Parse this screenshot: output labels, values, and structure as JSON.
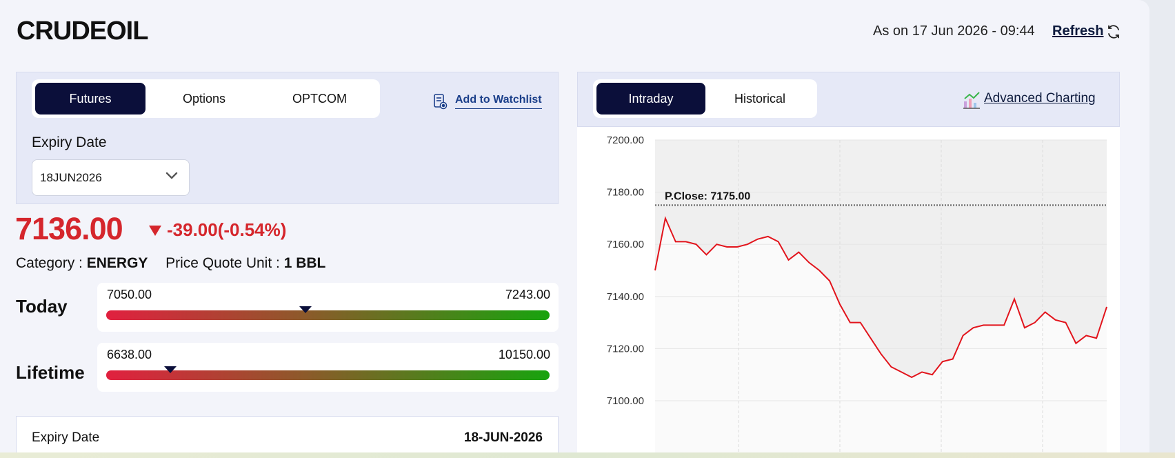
{
  "header": {
    "title": "CRUDEOIL",
    "as_on": "As on 17 Jun 2026 - 09:44",
    "refresh_label": "Refresh"
  },
  "left": {
    "tabs": [
      {
        "label": "Futures",
        "active": true
      },
      {
        "label": "Options",
        "active": false
      },
      {
        "label": "OPTCOM",
        "active": false
      }
    ],
    "watchlist_label": "Add to Watchlist",
    "expiry_label": "Expiry Date",
    "expiry_value": "18JUN2026",
    "price": "7136.00",
    "change": "-39.00(-0.54%)",
    "category_label": "Category :",
    "category_value": "ENERGY",
    "unit_label": "Price Quote Unit :",
    "unit_value": "1 BBL",
    "today": {
      "label": "Today",
      "low": "7050.00",
      "high": "7243.00",
      "position": 0.45
    },
    "lifetime": {
      "label": "Lifetime",
      "low": "6638.00",
      "high": "10150.00",
      "position": 0.145
    },
    "details": {
      "expiry_label": "Expiry Date",
      "expiry_value": "18-JUN-2026"
    }
  },
  "right": {
    "tabs": [
      {
        "label": "Intraday",
        "active": true
      },
      {
        "label": "Historical",
        "active": false
      }
    ],
    "advanced_label": "Advanced Charting"
  },
  "colors": {
    "accent": "#0b0f3a",
    "down": "#d5262c",
    "line": "#e2141c"
  },
  "chart_data": {
    "type": "line",
    "yticks": [
      "7200.00",
      "7180.00",
      "7160.00",
      "7140.00",
      "7120.00",
      "7100.00"
    ],
    "ylim": [
      7090,
      7200
    ],
    "prev_close_label": "P.Close: 7175.00",
    "prev_close": 7175,
    "series": [
      {
        "values": [
          7150,
          7170,
          7161,
          7161,
          7160,
          7156,
          7160,
          7159,
          7159,
          7160,
          7162,
          7163,
          7161,
          7154,
          7157,
          7153,
          7150,
          7146,
          7137,
          7130,
          7130,
          7124,
          7118,
          7113,
          7111,
          7109,
          7111,
          7110,
          7115,
          7116,
          7125,
          7128,
          7129,
          7129,
          7129,
          7139,
          7128,
          7130,
          7134,
          7131,
          7130,
          7122,
          7125,
          7124,
          7136
        ]
      }
    ]
  }
}
